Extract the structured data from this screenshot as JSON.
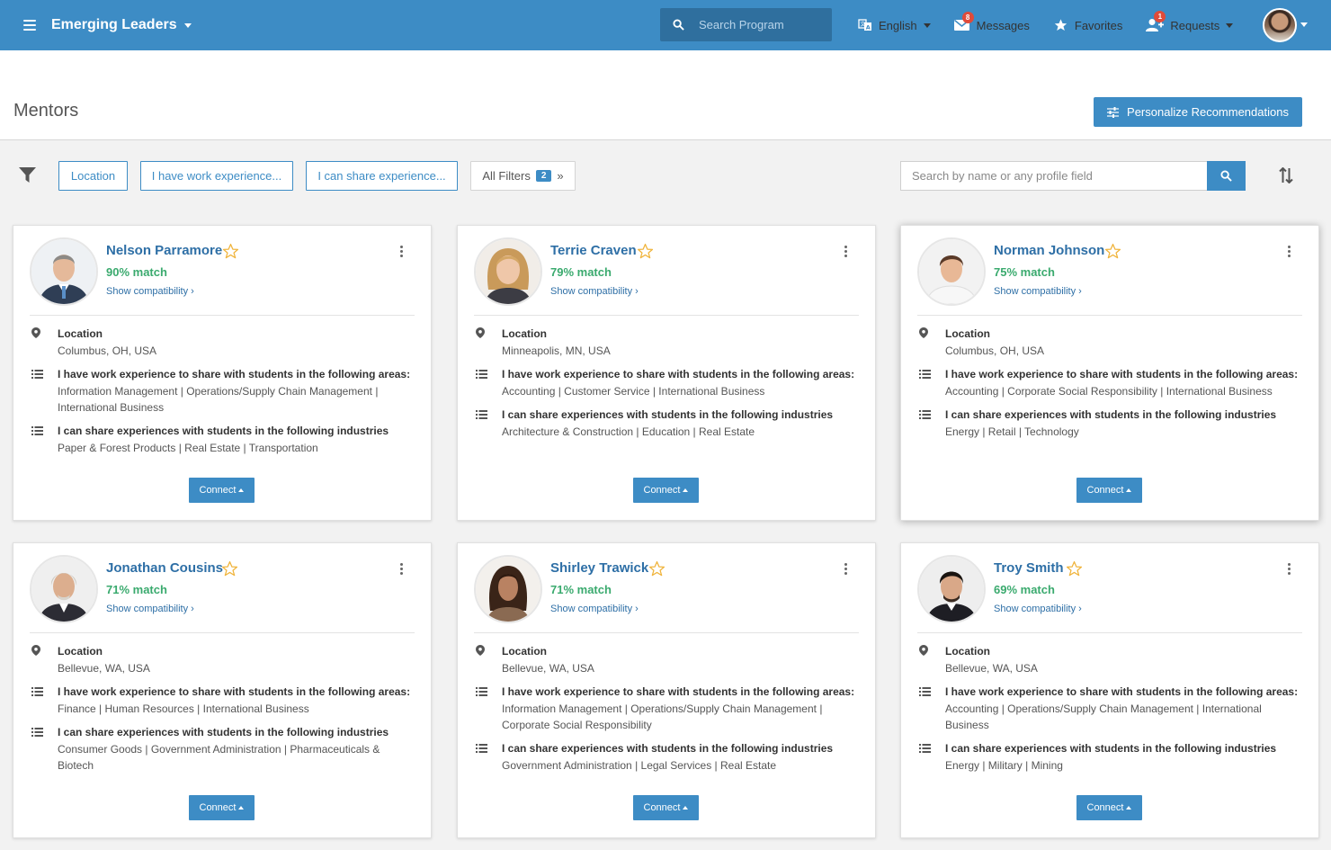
{
  "nav": {
    "program": "Emerging Leaders",
    "search_placeholder": "Search Program",
    "language": "English",
    "messages": "Messages",
    "messages_count": "8",
    "favorites": "Favorites",
    "requests": "Requests",
    "requests_count": "1"
  },
  "page": {
    "title": "Mentors",
    "personalize": "Personalize Recommendations"
  },
  "filters": {
    "location": "Location",
    "work_experience": "I have work experience...",
    "share_experience": "I can share experience...",
    "all_filters": "All Filters",
    "all_filters_count": "2",
    "all_filters_arrow": "»",
    "search_placeholder": "Search by name or any profile field"
  },
  "labels": {
    "location": "Location",
    "work_areas": "I have work experience to share with students in the following areas:",
    "industries": "I can share experiences with students in the following industries",
    "show_compat": "Show compatibility",
    "connect": "Connect"
  },
  "mentors": [
    {
      "name": "Nelson Parramore",
      "match": "90% match",
      "location": "Columbus, OH, USA",
      "work_areas": "Information Management | Operations/Supply Chain Management | International Business",
      "industries": "Paper & Forest Products | Real Estate | Transportation"
    },
    {
      "name": "Terrie Craven",
      "match": "79% match",
      "location": "Minneapolis, MN, USA",
      "work_areas": "Accounting | Customer Service | International Business",
      "industries": "Architecture & Construction | Education | Real Estate"
    },
    {
      "name": "Norman Johnson",
      "match": "75% match",
      "location": "Columbus, OH, USA",
      "work_areas": "Accounting | Corporate Social Responsibility | International Business",
      "industries": "Energy | Retail | Technology"
    },
    {
      "name": "Jonathan Cousins",
      "match": "71% match",
      "location": "Bellevue, WA, USA",
      "work_areas": "Finance | Human Resources | International Business",
      "industries": "Consumer Goods | Government Administration | Pharmaceuticals & Biotech"
    },
    {
      "name": "Shirley Trawick",
      "match": "71% match",
      "location": "Bellevue, WA, USA",
      "work_areas": "Information Management | Operations/Supply Chain Management | Corporate Social Responsibility",
      "industries": "Government Administration | Legal Services | Real Estate"
    },
    {
      "name": "Troy Smith",
      "match": "69% match",
      "location": "Bellevue, WA, USA",
      "work_areas": "Accounting | Operations/Supply Chain Management | International Business",
      "industries": "Energy | Military | Mining"
    }
  ],
  "colors": {
    "primary": "#3d8cc5",
    "match": "#3aaa6e",
    "name": "#2e6fa6",
    "badge": "#e04b3a",
    "star": "#f0b43c"
  },
  "icons": [
    "menu-icon",
    "search-icon",
    "translate-icon",
    "mail-icon",
    "star-icon",
    "user-plus-icon",
    "filter-icon",
    "sort-icon",
    "sliders-icon",
    "map-pin-icon",
    "list-icon",
    "kebab-icon"
  ]
}
